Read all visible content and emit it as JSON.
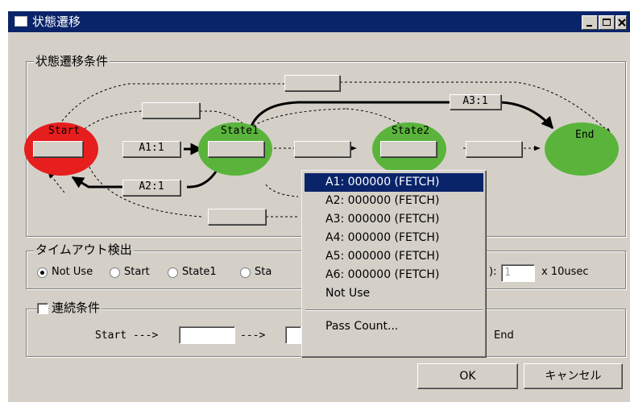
{
  "window": {
    "title": "状態遷移"
  },
  "transition_group": {
    "label": "状態遷移条件",
    "states": [
      "Start",
      "State1",
      "State2",
      "End"
    ],
    "conditions": [
      "A1:1",
      "A2:1",
      "A3:1"
    ]
  },
  "timeout_group": {
    "label": "タイムアウト検出",
    "radios": [
      {
        "label": "Not Use",
        "checked": true
      },
      {
        "label": "Start",
        "checked": false
      },
      {
        "label": "State1",
        "checked": false
      },
      {
        "label": "Sta",
        "checked": false
      }
    ],
    "partial_label": "):",
    "value": "1",
    "unit": "x 10usec"
  },
  "continuous_group": {
    "label": "連続条件",
    "checked": false,
    "sequence": [
      "Start --->",
      "--->",
      "End"
    ]
  },
  "buttons": {
    "ok": "OK",
    "cancel": "キャンセル"
  },
  "context_menu": {
    "items": [
      {
        "label": "A1: 000000 (FETCH)",
        "selected": true
      },
      {
        "label": "A2: 000000 (FETCH)",
        "selected": false
      },
      {
        "label": "A3: 000000 (FETCH)",
        "selected": false
      },
      {
        "label": "A4: 000000 (FETCH)",
        "selected": false
      },
      {
        "label": "A5: 000000 (FETCH)",
        "selected": false
      },
      {
        "label": "A6: 000000 (FETCH)",
        "selected": false
      },
      {
        "label": "Not Use",
        "selected": false
      }
    ],
    "footer_item": "Pass Count..."
  },
  "colors": {
    "start": "#e61e1e",
    "state": "#5ab43c",
    "titlebar": "#0a246a",
    "highlight": "#0a246a"
  }
}
